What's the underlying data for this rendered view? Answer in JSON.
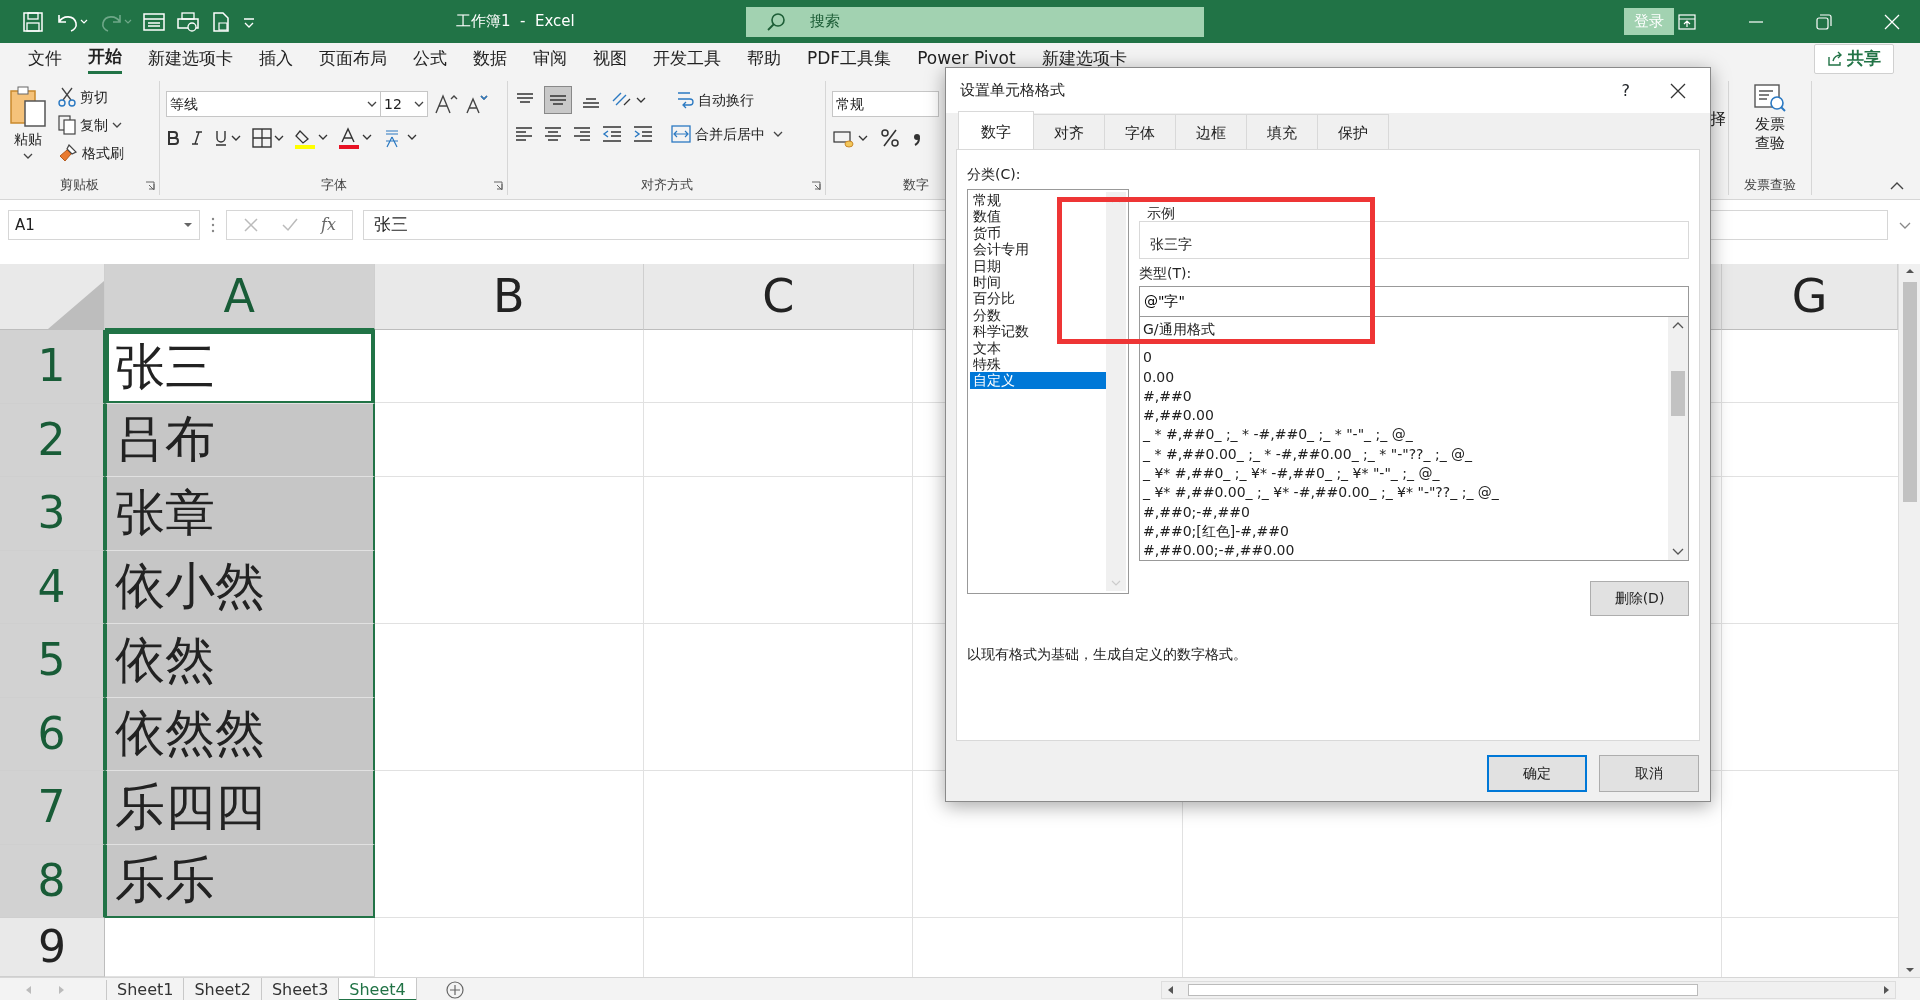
{
  "title_bar": {
    "title": "工作簿1  -  Excel",
    "search_placeholder": "搜索",
    "login": "登录"
  },
  "menu_tabs": [
    {
      "label": "文件",
      "selected": false
    },
    {
      "label": "开始",
      "selected": true
    },
    {
      "label": "新建选项卡",
      "selected": false
    },
    {
      "label": "插入",
      "selected": false
    },
    {
      "label": "页面布局",
      "selected": false
    },
    {
      "label": "公式",
      "selected": false
    },
    {
      "label": "数据",
      "selected": false
    },
    {
      "label": "审阅",
      "selected": false
    },
    {
      "label": "视图",
      "selected": false
    },
    {
      "label": "开发工具",
      "selected": false
    },
    {
      "label": "帮助",
      "selected": false
    },
    {
      "label": "PDF工具集",
      "selected": false
    },
    {
      "label": "Power Pivot",
      "selected": false
    },
    {
      "label": "新建选项卡",
      "selected": false
    }
  ],
  "share": "共享",
  "ribbon": {
    "clipboard": {
      "paste": "粘贴",
      "cut": "剪切",
      "copy": "复制",
      "format_painter": "格式刷",
      "label": "剪贴板"
    },
    "font": {
      "font_name": "等线",
      "font_size": "12",
      "label": "字体"
    },
    "alignment": {
      "wrap_text": "自动换行",
      "merge_center": "合并后居中",
      "label": "对齐方式"
    },
    "number": {
      "format": "常规",
      "label": "数字"
    },
    "cut_button": "择",
    "invoice": {
      "button": "发票查验",
      "label": "发票查验"
    }
  },
  "formula_bar": {
    "name_box": "A1",
    "insert_function": "fx",
    "content": "张三"
  },
  "sheet": {
    "columns": [
      {
        "label": "A",
        "selected": true
      },
      {
        "label": "B",
        "selected": false
      },
      {
        "label": "C",
        "selected": false
      },
      {
        "label": "G",
        "selected": false
      }
    ],
    "rows": [
      {
        "number": "1",
        "value": "张三",
        "selected": true,
        "active": true
      },
      {
        "number": "2",
        "value": "吕布",
        "selected": true,
        "active": false
      },
      {
        "number": "3",
        "value": "张章",
        "selected": true,
        "active": false
      },
      {
        "number": "4",
        "value": "依小然",
        "selected": true,
        "active": false
      },
      {
        "number": "5",
        "value": "依然",
        "selected": true,
        "active": false
      },
      {
        "number": "6",
        "value": "依然然",
        "selected": true,
        "active": false
      },
      {
        "number": "7",
        "value": "乐四四",
        "selected": true,
        "active": false
      },
      {
        "number": "8",
        "value": "乐乐",
        "selected": true,
        "active": false
      },
      {
        "number": "9",
        "selected": false,
        "active": false
      }
    ]
  },
  "sheet_tabs": [
    {
      "label": "Sheet1",
      "selected": false
    },
    {
      "label": "Sheet2",
      "selected": false
    },
    {
      "label": "Sheet3",
      "selected": false
    },
    {
      "label": "Sheet4",
      "selected": true
    }
  ],
  "dialog": {
    "title": "设置单元格格式",
    "help": "?",
    "tabs": [
      {
        "label": "数字",
        "selected": true
      },
      {
        "label": "对齐",
        "selected": false
      },
      {
        "label": "字体",
        "selected": false
      },
      {
        "label": "边框",
        "selected": false
      },
      {
        "label": "填充",
        "selected": false
      },
      {
        "label": "保护",
        "selected": false
      }
    ],
    "category_label": "分类(C):",
    "categories": [
      {
        "label": "常规",
        "selected": false
      },
      {
        "label": "数值",
        "selected": false
      },
      {
        "label": "货币",
        "selected": false
      },
      {
        "label": "会计专用",
        "selected": false
      },
      {
        "label": "日期",
        "selected": false
      },
      {
        "label": "时间",
        "selected": false
      },
      {
        "label": "百分比",
        "selected": false
      },
      {
        "label": "分数",
        "selected": false
      },
      {
        "label": "科学记数",
        "selected": false
      },
      {
        "label": "文本",
        "selected": false
      },
      {
        "label": "特殊",
        "selected": false
      },
      {
        "label": "自定义",
        "selected": true
      }
    ],
    "sample_label": "示例",
    "sample": "张三字",
    "type_label": "类型(T):",
    "type_value": "@\"字\"",
    "formats": [
      "G/通用格式",
      "0",
      "0.00",
      "#,##0",
      "#,##0.00",
      "_ * #,##0_ ;_ * -#,##0_ ;_ * \"-\"_ ;_ @_",
      "_ * #,##0.00_ ;_ * -#,##0.00_ ;_ * \"-\"??_ ;_ @_",
      "_ ¥* #,##0_ ;_ ¥* -#,##0_ ;_ ¥* \"-\"_ ;_ @_",
      "_ ¥* #,##0.00_ ;_ ¥* -#,##0.00_ ;_ ¥* \"-\"??_ ;_ @_",
      "#,##0;-#,##0",
      "#,##0;[红色]-#,##0",
      "#,##0.00;-#,##0.00"
    ],
    "delete": "删除(D)",
    "description": "以现有格式为基础，生成自定义的数字格式。",
    "ok": "确定",
    "cancel": "取消"
  }
}
